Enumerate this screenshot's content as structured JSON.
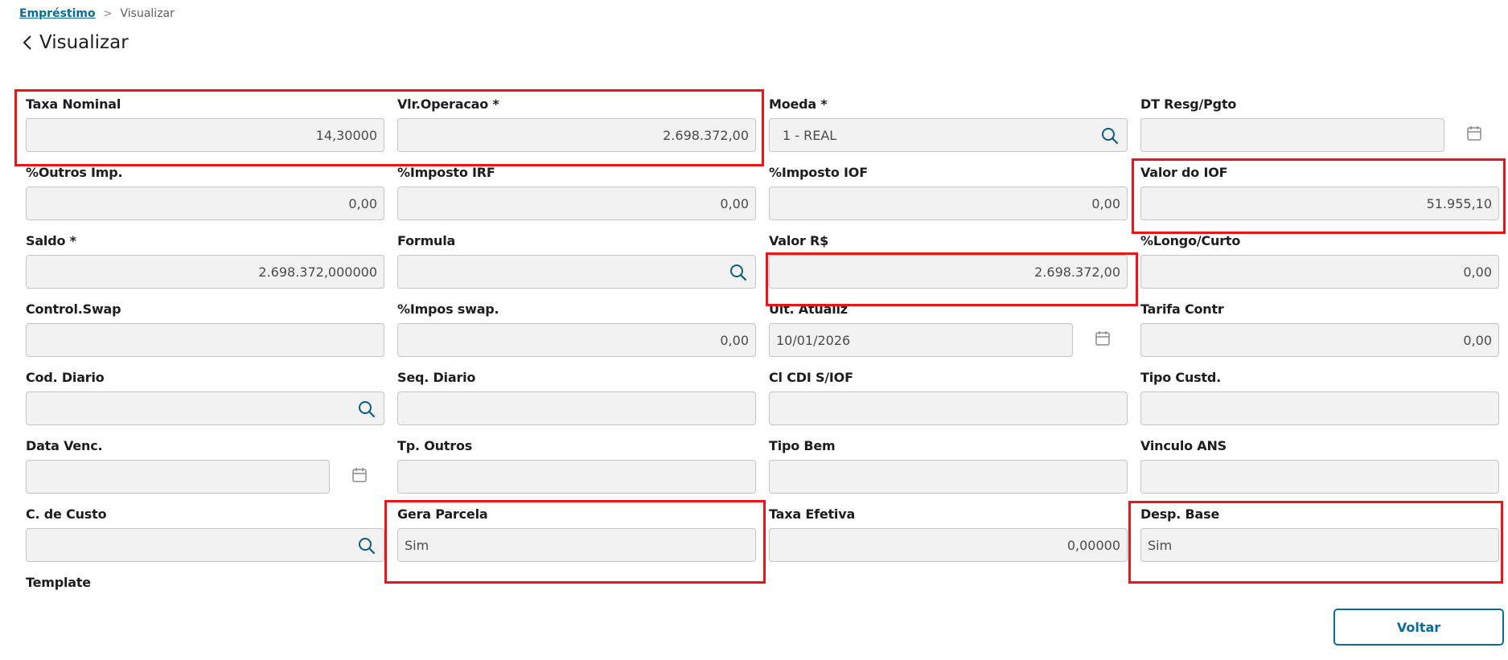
{
  "breadcrumb": {
    "parent": "Empréstimo",
    "current": "Visualizar"
  },
  "page": {
    "title": "Visualizar"
  },
  "fields": {
    "taxa_nominal": {
      "label": "Taxa Nominal",
      "value": "14,30000"
    },
    "vlr_operacao": {
      "label": "Vlr.Operacao *",
      "value": "2.698.372,00"
    },
    "moeda": {
      "label": "Moeda *",
      "value": "1 - REAL"
    },
    "dt_resg": {
      "label": "DT Resg/Pgto",
      "value": ""
    },
    "outros_imp": {
      "label": "%Outros Imp.",
      "value": "0,00"
    },
    "imposto_irf": {
      "label": "%Imposto IRF",
      "value": "0,00"
    },
    "imposto_iof": {
      "label": "%Imposto IOF",
      "value": "0,00"
    },
    "valor_iof": {
      "label": "Valor do IOF",
      "value": "51.955,10"
    },
    "saldo": {
      "label": "Saldo *",
      "value": "2.698.372,000000"
    },
    "formula": {
      "label": "Formula",
      "value": ""
    },
    "valor_rs": {
      "label": "Valor R$",
      "value": "2.698.372,00"
    },
    "longo_curto": {
      "label": "%Longo/Curto",
      "value": "0,00"
    },
    "control_swap": {
      "label": "Control.Swap",
      "value": ""
    },
    "impos_swap": {
      "label": "%Impos swap.",
      "value": "0,00"
    },
    "ult_atualiz": {
      "label": "Ult. Atualiz",
      "value": "10/01/2026"
    },
    "tarifa_contr": {
      "label": "Tarifa Contr",
      "value": "0,00"
    },
    "cod_diario": {
      "label": "Cod. Diario",
      "value": ""
    },
    "seq_diario": {
      "label": "Seq. Diario",
      "value": ""
    },
    "cl_cdi": {
      "label": "Cl CDI S/IOF",
      "value": ""
    },
    "tipo_custd": {
      "label": "Tipo Custd.",
      "value": ""
    },
    "data_venc": {
      "label": "Data Venc.",
      "value": ""
    },
    "tp_outros": {
      "label": "Tp. Outros",
      "value": ""
    },
    "tipo_bem": {
      "label": "Tipo Bem",
      "value": ""
    },
    "vinculo_ans": {
      "label": "Vinculo ANS",
      "value": ""
    },
    "c_custo": {
      "label": "C. de Custo",
      "value": ""
    },
    "gera_parcela": {
      "label": "Gera Parcela",
      "value": "Sim"
    },
    "taxa_efetiva": {
      "label": "Taxa Efetiva",
      "value": "0,00000"
    },
    "desp_base": {
      "label": "Desp. Base",
      "value": "Sim"
    },
    "template": {
      "label": "Template"
    }
  },
  "actions": {
    "voltar": "Voltar"
  },
  "colors": {
    "accent": "#0c6c94",
    "highlight": "#e8161b",
    "field_bg": "#f2f2f2"
  }
}
